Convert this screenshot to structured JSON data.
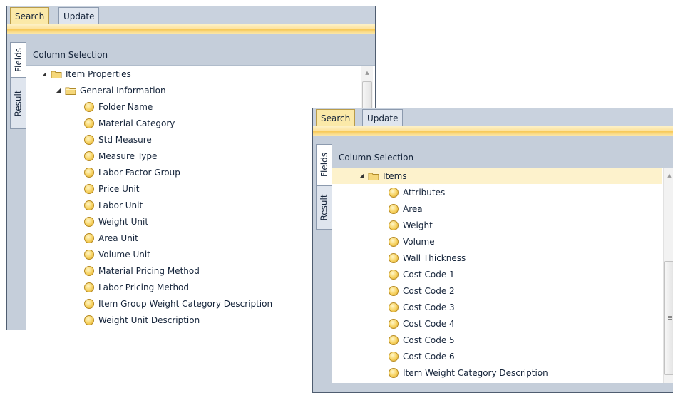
{
  "back": {
    "tabs": {
      "search": "Search",
      "update": "Update"
    },
    "side_tabs": {
      "fields": "Fields",
      "result": "Result"
    },
    "column_header": "Column Selection",
    "tree": {
      "root": "Item Properties",
      "group": "General Information",
      "fields": [
        "Folder Name",
        "Material Category",
        "Std Measure",
        "Measure Type",
        "Labor Factor Group",
        "Price Unit",
        "Labor Unit",
        "Weight Unit",
        "Area Unit",
        "Volume Unit",
        "Material Pricing Method",
        "Labor Pricing Method",
        "Item Group Weight Category Description",
        "Weight Unit Description"
      ]
    }
  },
  "front": {
    "tabs": {
      "search": "Search",
      "update": "Update"
    },
    "side_tabs": {
      "fields": "Fields",
      "result": "Result"
    },
    "column_header": "Column Selection",
    "tree": {
      "group": "Items",
      "fields": [
        "Attributes",
        "Area",
        "Weight",
        "Volume",
        "Wall Thickness",
        "Cost Code 1",
        "Cost Code 2",
        "Cost Code 3",
        "Cost Code 4",
        "Cost Code 5",
        "Cost Code 6",
        "Item Weight Category Description"
      ]
    }
  },
  "icons": {
    "expander": "expanded-triangle-icon",
    "folder": "folder-icon",
    "field": "field-dot-icon",
    "scroll_up": "scroll-up-arrow-icon"
  },
  "colors": {
    "active_tab": "#fbe9a8",
    "panel_bg": "#c5ceda",
    "selected_row": "#fdf2cc",
    "field_icon": "#f7d260"
  }
}
